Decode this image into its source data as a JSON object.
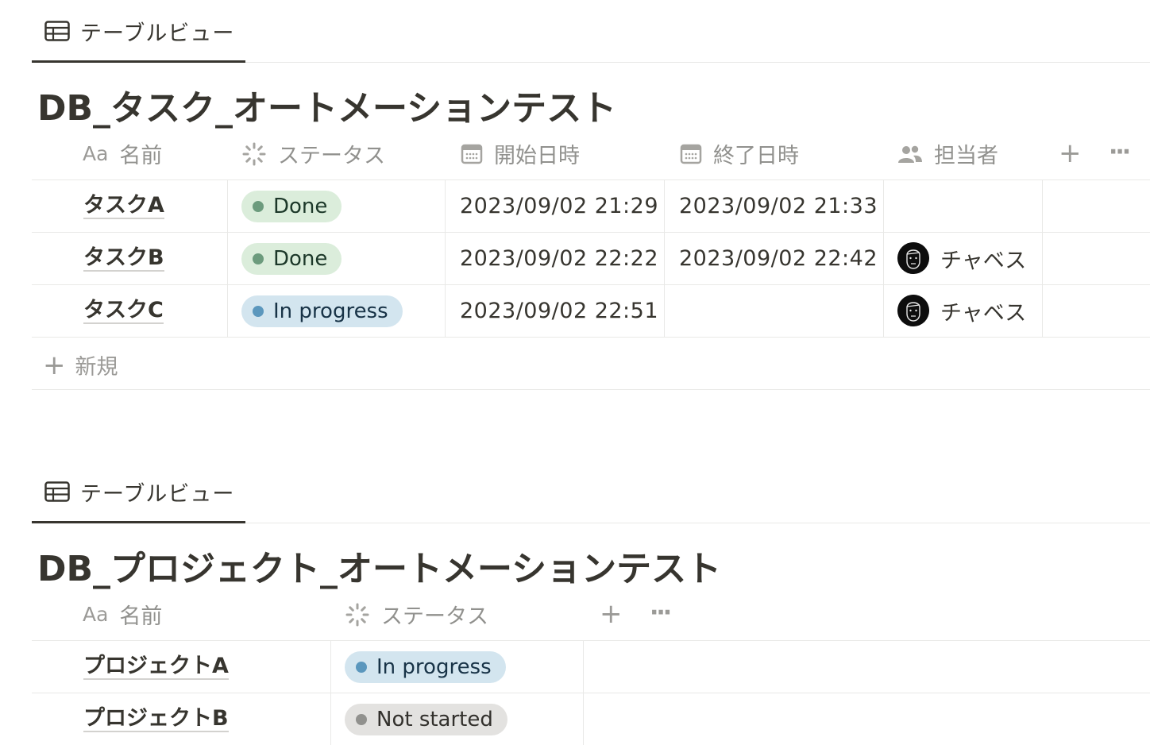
{
  "view1": {
    "tab_label": "テーブルビュー",
    "title": "DB_タスク_オートメーションテスト",
    "columns": {
      "name": {
        "prefix": "Aa",
        "label": "名前"
      },
      "status": {
        "label": "ステータス"
      },
      "start": {
        "label": "開始日時"
      },
      "end": {
        "label": "終了日時"
      },
      "assignee": {
        "label": "担当者"
      }
    },
    "rows": [
      {
        "name": "タスクA",
        "status": "Done",
        "start": "2023/09/02 21:29",
        "end": "2023/09/02 21:33",
        "assignee": ""
      },
      {
        "name": "タスクB",
        "status": "Done",
        "start": "2023/09/02 22:22",
        "end": "2023/09/02 22:42",
        "assignee": "チャベス"
      },
      {
        "name": "タスクC",
        "status": "In progress",
        "start": "2023/09/02 22:51",
        "end": "",
        "assignee": "チャベス"
      }
    ],
    "new_label": "新規",
    "add_icon": "plus-icon",
    "more_icon": "ellipsis-icon"
  },
  "view2": {
    "tab_label": "テーブルビュー",
    "title": "DB_プロジェクト_オートメーションテスト",
    "columns": {
      "name": {
        "prefix": "Aa",
        "label": "名前"
      },
      "status": {
        "label": "ステータス"
      }
    },
    "rows": [
      {
        "name": "プロジェクトA",
        "status": "In progress"
      },
      {
        "name": "プロジェクトB",
        "status": "Not started"
      }
    ]
  },
  "colors": {
    "done_bg": "#dbeddb",
    "done_dot": "#6c9b7d",
    "progress_bg": "#d3e5ef",
    "progress_dot": "#5b97bd",
    "notstarted_bg": "#e3e2e0",
    "notstarted_dot": "#91918e"
  }
}
